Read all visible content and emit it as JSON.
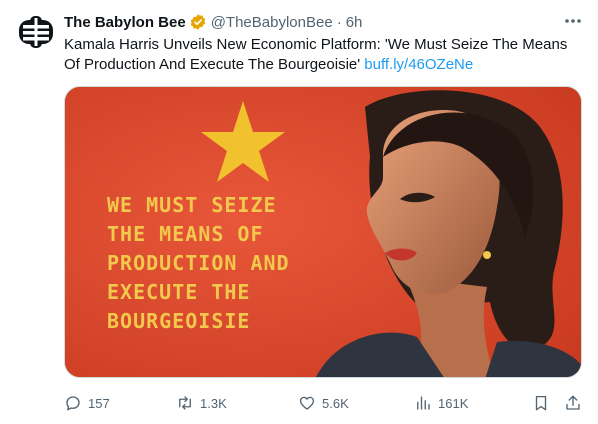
{
  "author": {
    "display_name": "The Babylon Bee",
    "handle": "@TheBabylonBee",
    "separator": "·",
    "timestamp": "6h",
    "verified_color": "#e8a400"
  },
  "tweet": {
    "text": "Kamala Harris Unveils New Economic Platform: 'We Must Seize The Means Of Production And Execute The Bourgeoisie' ",
    "link_text": "buff.ly/46OZeNe"
  },
  "media": {
    "poster_lines": [
      "WE MUST SEIZE",
      "THE MEANS OF",
      "PRODUCTION AND",
      "EXECUTE THE",
      "BOURGEOISIE"
    ],
    "background_color": "#e04a2a",
    "star_color": "#f2c12e",
    "text_color": "#f2c94c"
  },
  "actions": {
    "replies": "157",
    "retweets": "1.3K",
    "likes": "5.6K",
    "views": "161K"
  },
  "icons": {
    "more": "more-horizontal-icon",
    "reply": "reply-icon",
    "retweet": "retweet-icon",
    "like": "heart-icon",
    "views": "views-chart-icon",
    "bookmark": "bookmark-icon",
    "share": "share-icon"
  },
  "colors": {
    "text_primary": "#0f1419",
    "text_secondary": "#536471",
    "link": "#1d9bf0"
  }
}
